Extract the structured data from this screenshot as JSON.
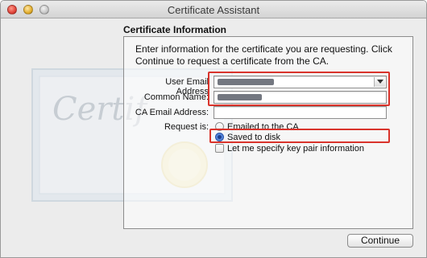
{
  "window": {
    "title": "Certificate Assistant"
  },
  "watermark": {
    "text": "Certif"
  },
  "section": {
    "heading": "Certificate Information",
    "intro": "Enter information for the certificate you are requesting. Click Continue to request a certificate from the CA."
  },
  "form": {
    "user_email_label": "User Email Address",
    "user_email_value": "",
    "common_name_label": "Common Name:",
    "common_name_value": "",
    "ca_email_label": "CA Email Address:",
    "ca_email_value": "",
    "request_is_label": "Request is:",
    "options": {
      "emailed": "Emailed to the CA",
      "saved": "Saved to disk",
      "keypair": "Let me specify key pair information"
    },
    "selected_option": "Saved to disk",
    "keypair_checked": false
  },
  "buttons": {
    "continue": "Continue"
  },
  "colors": {
    "highlight": "#d9332b",
    "radio_selected": "#3c6fd1"
  }
}
